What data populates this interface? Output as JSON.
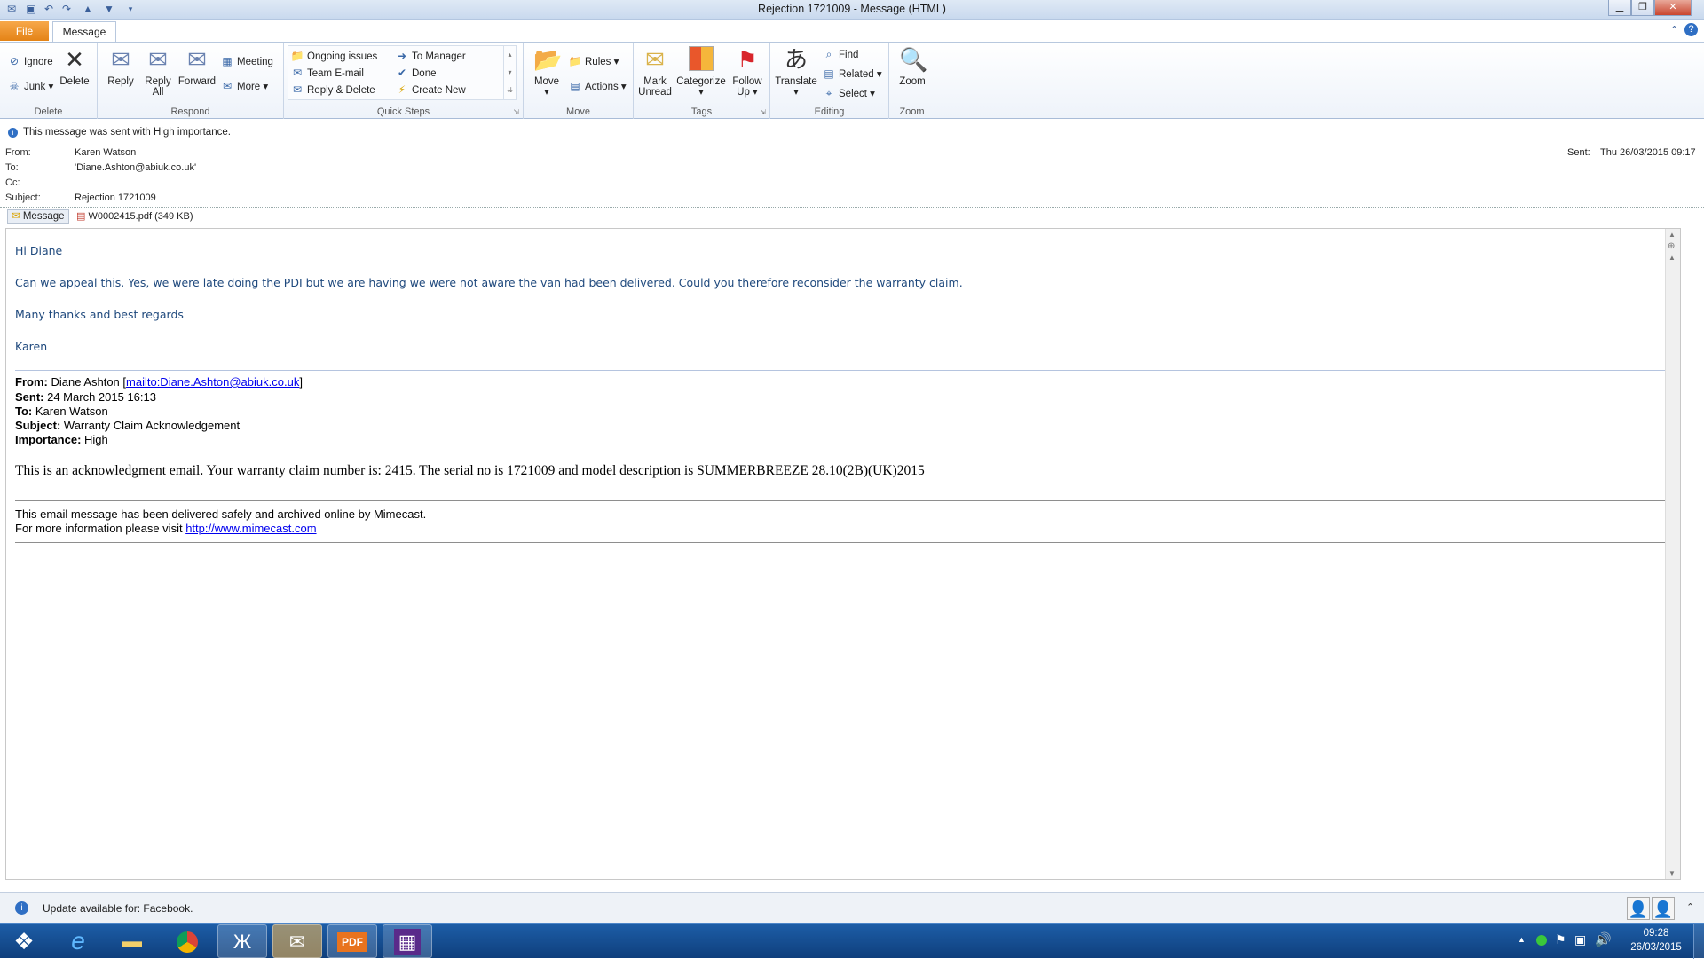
{
  "window": {
    "title": "Rejection 1721009  -  Message (HTML)"
  },
  "tabs": {
    "file": "File",
    "message": "Message"
  },
  "ribbon": {
    "delete": {
      "label": "Delete",
      "ignore": "Ignore",
      "junk": "Junk",
      "delete": "Delete"
    },
    "respond": {
      "label": "Respond",
      "reply": "Reply",
      "reply_all_1": "Reply",
      "reply_all_2": "All",
      "forward": "Forward",
      "meeting": "Meeting",
      "more": "More"
    },
    "quick_steps": {
      "label": "Quick Steps",
      "items": [
        "Ongoing issues",
        "Team E-mail",
        "Reply & Delete",
        "To Manager",
        "Done",
        "Create New"
      ]
    },
    "move": {
      "label": "Move",
      "move": "Move",
      "rules": "Rules",
      "actions": "Actions"
    },
    "tags": {
      "label": "Tags",
      "mark_unread_1": "Mark",
      "mark_unread_2": "Unread",
      "categorize": "Categorize",
      "follow_up_1": "Follow",
      "follow_up_2": "Up"
    },
    "editing": {
      "label": "Editing",
      "translate": "Translate",
      "find": "Find",
      "related": "Related",
      "select": "Select"
    },
    "zoom": {
      "label": "Zoom",
      "zoom": "Zoom"
    }
  },
  "header": {
    "importance_note": "This message was sent with High importance.",
    "from_label": "From:",
    "from": "Karen Watson",
    "to_label": "To:",
    "to": "'Diane.Ashton@abiuk.co.uk'",
    "cc_label": "Cc:",
    "subject_label": "Subject:",
    "subject": "Rejection 1721009",
    "sent_label": "Sent:",
    "sent": "Thu 26/03/2015 09:17",
    "message_tab": "Message",
    "attachment": "W0002415.pdf (349 KB)"
  },
  "body": {
    "greeting": "Hi Diane",
    "para1": "Can we appeal this. Yes, we were late doing the PDI but we are having we were not aware the van had been delivered. Could you therefore reconsider the warranty claim.",
    "closing": "Many thanks and best regards",
    "signature": "Karen",
    "fwd_from_label": "From:",
    "fwd_from": " Diane Ashton [",
    "fwd_from_link": "mailto:Diane.Ashton@abiuk.co.uk",
    "fwd_from_end": "]",
    "fwd_sent_label": "Sent:",
    "fwd_sent": " 24 March 2015 16:13",
    "fwd_to_label": "To:",
    "fwd_to": " Karen Watson",
    "fwd_subject_label": "Subject:",
    "fwd_subject": " Warranty Claim Acknowledgement",
    "fwd_importance_label": "Importance:",
    "fwd_importance": " High",
    "ack": "This is an acknowledgment email. Your warranty claim number is: 2415. The serial no is 1721009 and model description is SUMMERBREEZE 28.10(2B)(UK)2015",
    "mimecast1": "This email message has been delivered safely and archived online by Mimecast.",
    "mimecast2": "For more information please visit ",
    "mimecast_link": "http://www.mimecast.com"
  },
  "people_pane": {
    "update": "Update available for: Facebook."
  },
  "taskbar": {
    "time": "09:28",
    "date": "26/03/2015"
  }
}
